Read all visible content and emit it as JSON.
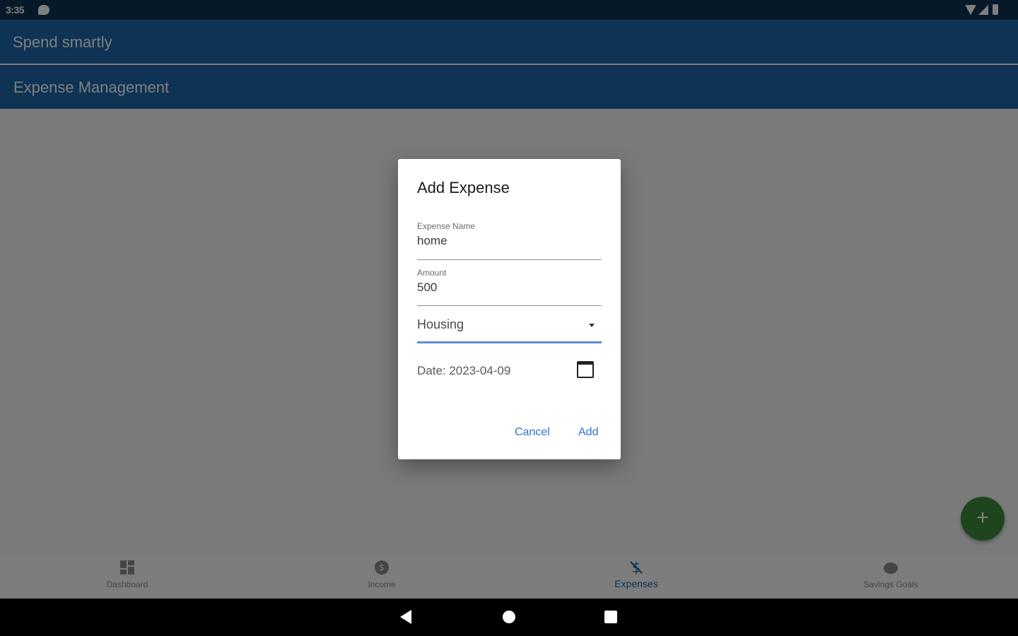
{
  "status_bar": {
    "time": "3:35"
  },
  "app": {
    "title": "Spend smartly",
    "section_title": "Expense Management"
  },
  "bottom_nav": [
    {
      "label": "Dashboard",
      "icon": "dashboard-icon",
      "active": false
    },
    {
      "label": "Income",
      "icon": "income-icon",
      "active": false
    },
    {
      "label": "Expenses",
      "icon": "expenses-icon",
      "active": true
    },
    {
      "label": "Savings Goals",
      "icon": "savings-icon",
      "active": false
    }
  ],
  "fab": {
    "label": "+"
  },
  "dialog": {
    "title": "Add Expense",
    "name_field": {
      "label": "Expense Name",
      "value": "home"
    },
    "amount_field": {
      "label": "Amount",
      "value": "500"
    },
    "category_field": {
      "value": "Housing"
    },
    "date_text": "Date: 2023-04-09",
    "cancel_label": "Cancel",
    "add_label": "Add"
  },
  "colors": {
    "primary": "#1d66a8",
    "status_bar": "#0f3253",
    "accent": "#2f74d0",
    "fab": "#3c8a3c"
  }
}
